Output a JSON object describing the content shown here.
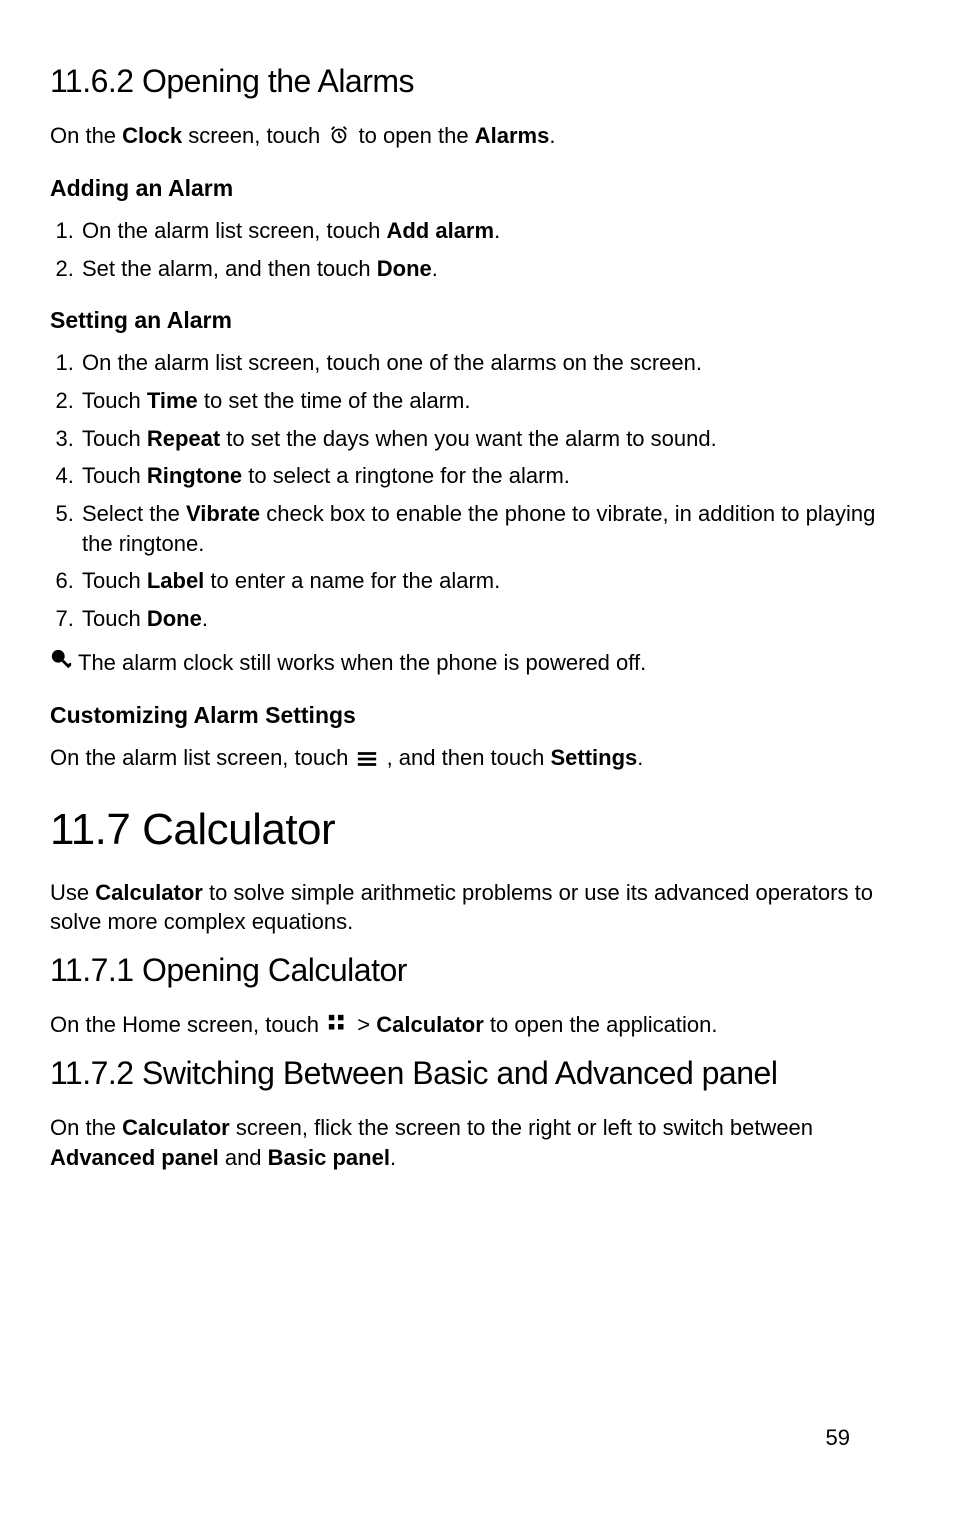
{
  "s1162": {
    "heading": "11.6.2  Opening the Alarms",
    "intro_pre": "On the ",
    "intro_b1": "Clock",
    "intro_mid": " screen, touch  ",
    "intro_post": "  to open the ",
    "intro_b2": "Alarms",
    "intro_end": "."
  },
  "adding": {
    "heading": "Adding an Alarm",
    "step1_pre": "On the alarm list screen, touch ",
    "step1_b": "Add alarm",
    "step1_end": ".",
    "step2_pre": "Set the alarm, and then touch ",
    "step2_b": "Done",
    "step2_end": "."
  },
  "setting": {
    "heading": "Setting an Alarm",
    "s1": "On the alarm list screen, touch one of the alarms on the screen.",
    "s2_pre": "Touch ",
    "s2_b": "Time",
    "s2_end": " to set the time of the alarm.",
    "s3_pre": "Touch ",
    "s3_b": "Repeat",
    "s3_end": " to set the days when you want the alarm to sound.",
    "s4_pre": "Touch ",
    "s4_b": "Ringtone",
    "s4_end": " to select a ringtone for the alarm.",
    "s5_pre": "Select the ",
    "s5_b": "Vibrate",
    "s5_end": " check box to enable the phone to vibrate, in addition to playing the ringtone.",
    "s6_pre": "Touch ",
    "s6_b": "Label",
    "s6_end": " to enter a name for the alarm.",
    "s7_pre": "Touch ",
    "s7_b": "Done",
    "s7_end": "."
  },
  "note": "The alarm clock still works when the phone is powered off.",
  "custom": {
    "heading": "Customizing Alarm Settings",
    "text_pre": "On the alarm list screen, touch  ",
    "text_mid": " , and then touch ",
    "text_b": "Settings",
    "text_end": "."
  },
  "s117": {
    "heading": "11.7  Calculator",
    "intro_pre": "Use ",
    "intro_b": "Calculator",
    "intro_end": " to solve simple arithmetic problems or use its advanced operators to solve more complex equations."
  },
  "s1171": {
    "heading": "11.7.1  Opening Calculator",
    "text_pre": "On the Home screen, touch  ",
    "text_mid": "  > ",
    "text_b": "Calculator",
    "text_end": " to open the application."
  },
  "s1172": {
    "heading": "11.7.2  Switching Between Basic and Advanced panel",
    "text_pre": "On the ",
    "text_b1": "Calculator",
    "text_mid": " screen, flick the screen to the right or left to switch between ",
    "text_b2": "Advanced panel",
    "text_and": " and ",
    "text_b3": "Basic panel",
    "text_end": "."
  },
  "pagenum": "59"
}
